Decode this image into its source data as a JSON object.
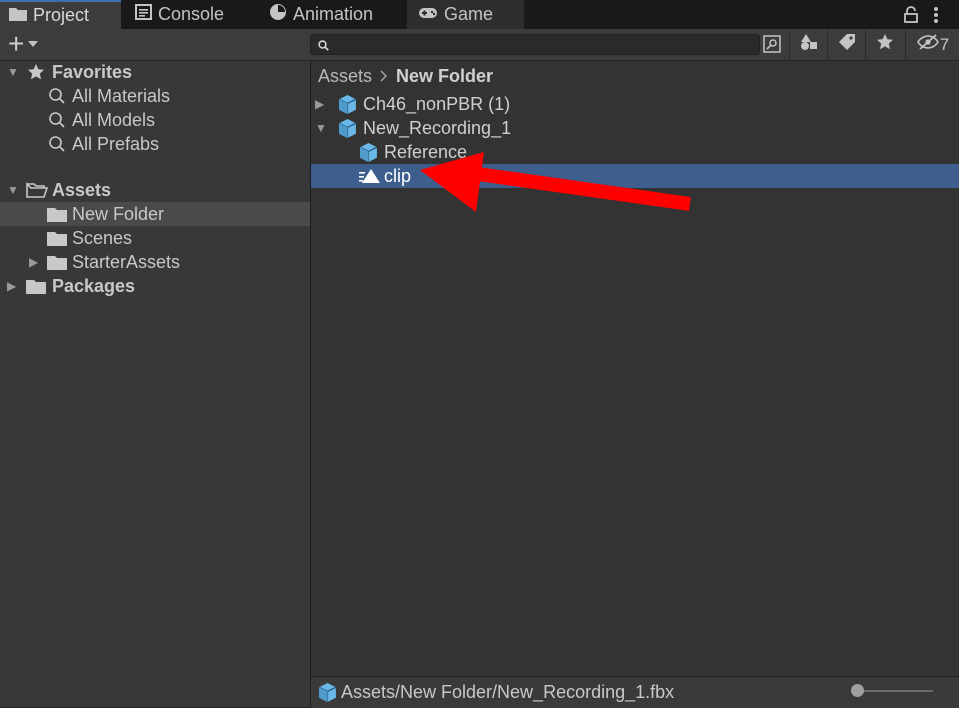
{
  "tabs": [
    {
      "label": "Project",
      "icon": "folder-icon",
      "active": true
    },
    {
      "label": "Console",
      "icon": "console-icon"
    },
    {
      "label": "Animation",
      "icon": "animation-icon"
    },
    {
      "label": "Game",
      "icon": "gamepad-icon"
    }
  ],
  "toolbar": {
    "add_label": "+",
    "hidden_count": "7"
  },
  "search": {
    "value": "",
    "placeholder": ""
  },
  "sidebar": {
    "favorites": {
      "label": "Favorites",
      "items": [
        "All Materials",
        "All Models",
        "All Prefabs"
      ]
    },
    "assets": {
      "label": "Assets",
      "items": [
        "New Folder",
        "Scenes",
        "StarterAssets"
      ],
      "selected": "New Folder"
    },
    "packages": {
      "label": "Packages"
    }
  },
  "breadcrumb": {
    "root": "Assets",
    "current": "New Folder"
  },
  "assets_list": [
    {
      "label": "Ch46_nonPBR (1)",
      "icon": "model-prefab-icon",
      "expanded": false
    },
    {
      "label": "New_Recording_1",
      "icon": "model-prefab-icon",
      "expanded": true
    },
    {
      "label": "Reference",
      "icon": "model-prefab-icon",
      "child": true
    },
    {
      "label": "clip",
      "icon": "animation-clip-icon",
      "child": true,
      "selected": true
    }
  ],
  "status": {
    "path": "Assets/New Folder/New_Recording_1.fbx",
    "zoom": 0.1
  },
  "colors": {
    "selection": "#3e5f8e",
    "annotation_arrow": "#ff0000",
    "prefab_icon": "#6ab8e8"
  }
}
